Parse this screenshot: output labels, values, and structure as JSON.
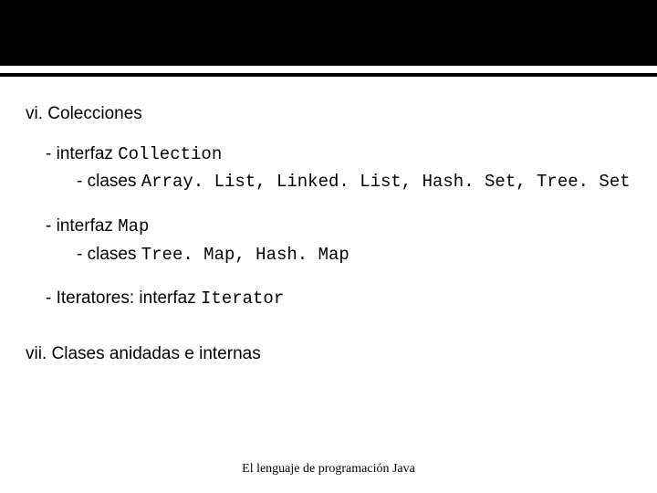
{
  "section_vi": {
    "title": "vi. Colecciones",
    "item1": {
      "prefix": "- interfaz ",
      "code": "Collection",
      "sub_prefix": "- clases ",
      "sub_code": "Array. List, Linked. List, Hash. Set, Tree. Set"
    },
    "item2": {
      "prefix": "- interfaz ",
      "code": "Map",
      "sub_prefix": "- clases ",
      "sub_code": "Tree. Map, Hash. Map"
    },
    "item3": {
      "prefix": "- Iteratores: interfaz ",
      "code": "Iterator"
    }
  },
  "section_vii": {
    "title": "vii. Clases anidadas e internas"
  },
  "footer": "El lenguaje de programación Java"
}
